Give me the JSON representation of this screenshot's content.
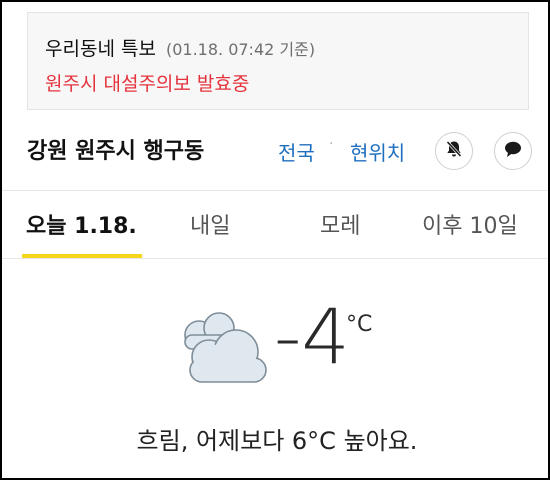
{
  "alert": {
    "title": "우리동네 특보",
    "time": "(01.18. 07:42 기준)",
    "message": "원주시 대설주의보 발효중",
    "message_color": "#e5333d"
  },
  "location": {
    "name": "강원 원주시 행구동",
    "nationwide_label": "전국",
    "separator": "·",
    "current_location_label": "현위치",
    "link_color": "#1f6fbf",
    "bell_icon": "bell-off-icon",
    "chat_icon": "chat-bubble-icon"
  },
  "tabs": [
    {
      "label": "오늘 1.18.",
      "active": true
    },
    {
      "label": "내일",
      "active": false
    },
    {
      "label": "모레",
      "active": false
    },
    {
      "label": "이후 10일",
      "active": false
    }
  ],
  "tab_accent_color": "#f7d51a",
  "weather": {
    "icon": "cloud-icon",
    "temperature": "-4",
    "unit": "°C",
    "summary": "흐림, 어제보다 6°C 높아요."
  }
}
